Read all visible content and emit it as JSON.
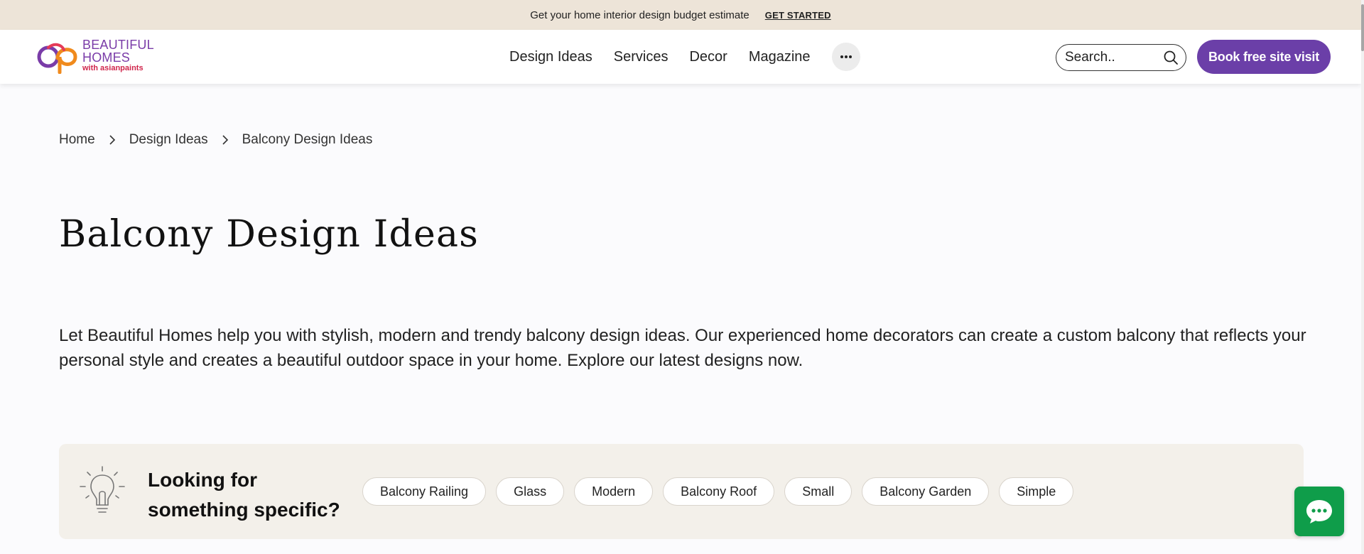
{
  "promo": {
    "text": "Get your home interior design budget estimate",
    "cta": "GET STARTED"
  },
  "logo": {
    "line1": "BEAUTIFUL",
    "line2": "HOMES",
    "line3": "with asianpaints"
  },
  "nav": {
    "items": [
      "Design Ideas",
      "Services",
      "Decor",
      "Magazine"
    ],
    "more_icon": "ellipsis-icon"
  },
  "search": {
    "placeholder": "Search..",
    "icon": "search-icon"
  },
  "book_button": "Book free site visit",
  "breadcrumb": [
    "Home",
    "Design Ideas",
    "Balcony Design Ideas"
  ],
  "page": {
    "title": "Balcony Design Ideas",
    "intro": "Let Beautiful Homes help you with stylish, modern and trendy balcony design ideas. Our experienced home decorators can create a custom balcony that reflects your personal style and creates a beautiful outdoor space in your home. Explore our latest designs now."
  },
  "specific": {
    "title": "Looking for something specific?",
    "chips": [
      "Balcony Railing",
      "Glass",
      "Modern",
      "Balcony Roof",
      "Small",
      "Balcony Garden",
      "Simple"
    ]
  },
  "colors": {
    "promo_bg": "#ede4d8",
    "accent_purple": "#6b3fa8",
    "chat_green": "#0f9d4a",
    "section_bg": "#f3f0ea"
  }
}
